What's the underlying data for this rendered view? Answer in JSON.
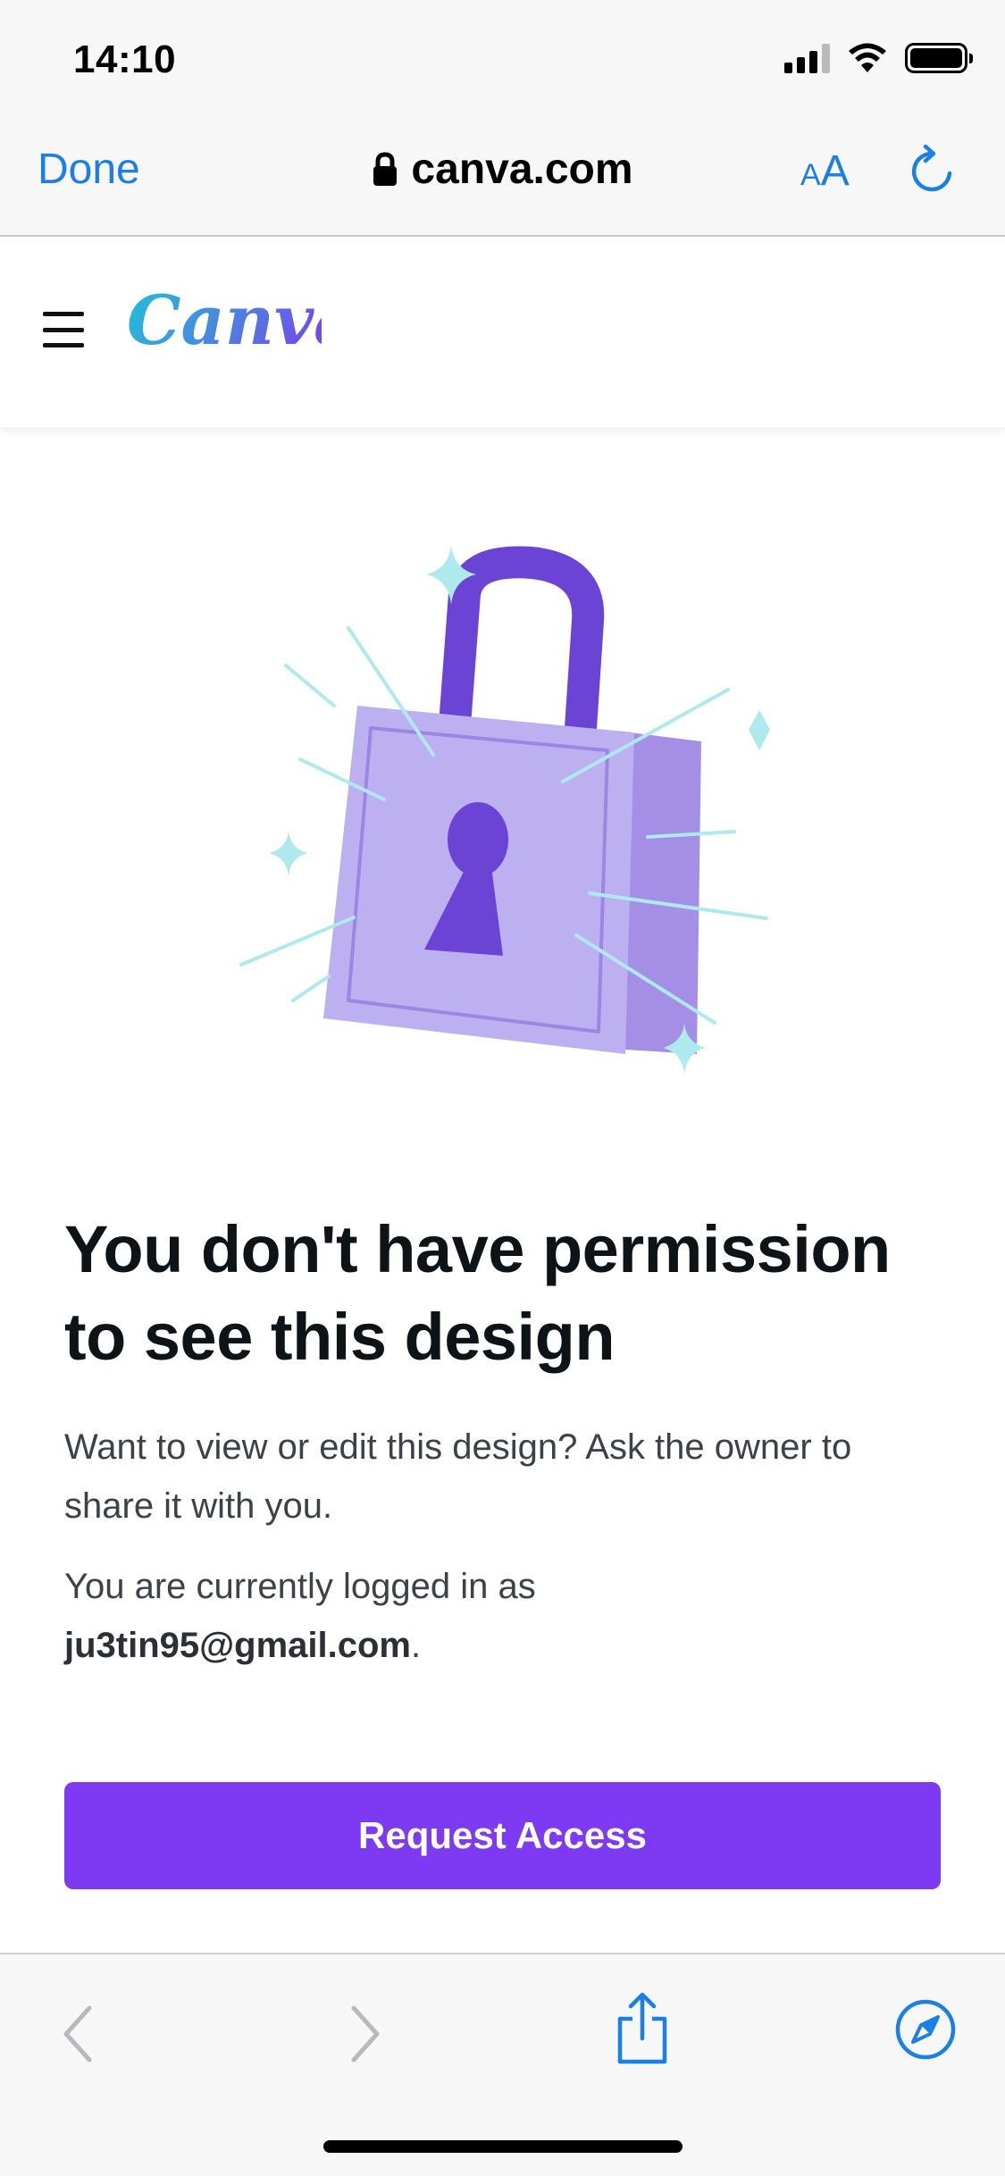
{
  "status_bar": {
    "time": "14:10"
  },
  "browser": {
    "done_label": "Done",
    "url": "canva.com",
    "text_size_small": "A",
    "text_size_big": "A"
  },
  "header": {
    "logo_text": "Canva"
  },
  "main": {
    "title": "You don't have permission to see this design",
    "description": "Want to view or edit this design? Ask the owner to share it with you.",
    "logged_in_prefix": "You are currently logged in as",
    "logged_in_email": "ju3tin95@gmail.com",
    "logged_in_suffix": ".",
    "request_button_label": "Request Access"
  },
  "colors": {
    "accent": "#7d3af2",
    "ios_blue": "#1a7fe6",
    "lock_light": "#bdb0f0",
    "lock_dark": "#6b44d6",
    "sparkle": "#aee9ee"
  }
}
